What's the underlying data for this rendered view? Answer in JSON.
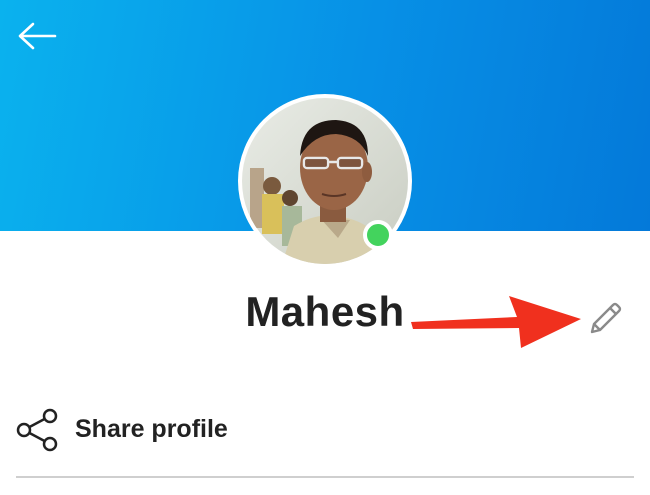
{
  "profile": {
    "name": "Mahesh",
    "online": true
  },
  "actions": {
    "share_label": "Share profile"
  },
  "icons": {
    "back": "arrow-left-icon",
    "edit": "pencil-icon",
    "share": "share-icon"
  },
  "colors": {
    "header_start": "#0ab2ee",
    "header_end": "#0479d9",
    "presence": "#43d35d",
    "annotation_arrow": "#f0301e",
    "text": "#222222"
  }
}
